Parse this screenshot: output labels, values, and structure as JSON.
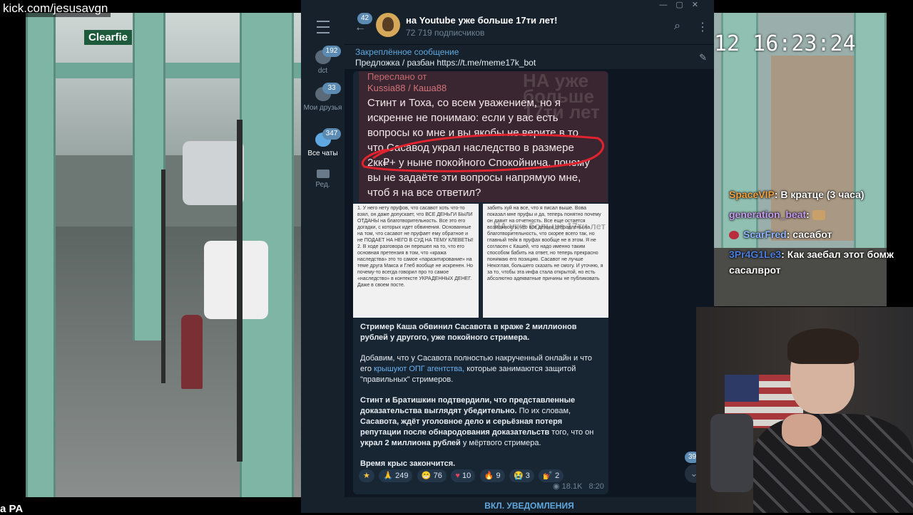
{
  "stream": {
    "kick_url": "kick.com/jesusavgn",
    "bottom_left_label": "a PA",
    "street_sign": "Clearfie",
    "clock": "12 16:23:24"
  },
  "telegram": {
    "rail": [
      {
        "label": "dct",
        "badge": "192"
      },
      {
        "label": "Мои друзья",
        "badge": "33"
      },
      {
        "label": "Все чаты",
        "badge": "347",
        "active": true
      },
      {
        "label": "Ред.",
        "badge": ""
      }
    ],
    "header": {
      "back_badge": "42",
      "channel_title": "на Youtube уже больше 17ти лет!",
      "subscribers": "72 719 подписчиков"
    },
    "pinned": {
      "title": "Закреплённое сообщение",
      "text": "Предложка / разбан https://t.me/meme17k_bot"
    },
    "forwarded": {
      "from_label": "Переслано от",
      "from_user": "Kussia88 / Каша88",
      "text": "Стинт и Тоха, со всем уважением, но я искренне не понимаю: если у вас есть вопросы ко мне и вы якобы не верите в то что Сасавод украл наследство в размере 2кк₽+ у ныне покойного Спокойнича, почему вы не задаёте эти вопросы напрямую мне, чтоб я на все ответил?",
      "watermark": "НА уже больше 17ти лет"
    },
    "screenshots": {
      "left_text": "1. У него нету пруфов, что сасавот хоть что-то взял, он даже допускает, что ВСЕ ДЕНЬГИ БЫЛИ ОТДАНЫ на благотворительность. Все это его догадки, с которых идет обвинения. Основанные на том, что сасавот не пруфает ему обратное и не ПОДАЕТ НА НЕГО В СУД НА ТЕМУ КЛЕВЕТЫ! 2. В ходе разговора он перешел на то, что его основная претензия в том, что «кража наследства» это то самое «паразитирование» на теме друга Макса и Глеб вообще не искренен. Но почему-то всегда говорил про то самое «наследство» в контексте УКРАДЕННЫХ ДЕНЕГ. Даже в своем посте.",
      "right_text": "забить хуй на все, что я писал выше. Вова показал мне пруфы и да, теперь понятно почему он давит на отчетность. Все еще остается возможность, что все деньги отправлены на благотворительность, что скорее всего так, но главный тейк в пруфах вообще не в этом. Я не согласен с Кашей, что надо именно таким способом бабить на ответ, но теперь прекрасно понимаю его позицию. Сасавот не лучше Некоглая, большего сказать не смогу. И уточню, я за то, чтобы эта инфа стала открытой, но есть абсолютно адекватные причины не публиковать",
      "watermark": "НА уже больше 17ти лет"
    },
    "post": {
      "p1": "Стример Каша обвинил Сасавота в краже 2 миллионов рублей у другого, уже покойного стримера.",
      "p2_a": "Добавим, что у Сасавота полностью накрученный онлайн и что его ",
      "p2_link": "крышуют ОПГ агентства,",
      "p2_b": " которые занимаются защитой \"правильных\" стримеров.",
      "p3_a": "Стинт и Братишкин подтвердили, что представленные доказательства выглядят убедительно.",
      "p3_b": " По их словам, ",
      "p3_c": "Сасавота, ждёт уголовное дело и серьёзная потеря репутации после обнародования доказательств",
      "p3_d": " того, что он ",
      "p3_e": "украл 2 миллиона рублей",
      "p3_f": " у мёртвого стримера.",
      "p4": "Время крыс закончится."
    },
    "reactions": [
      {
        "emoji": "★",
        "count": "",
        "color": "#f5c542"
      },
      {
        "emoji": "🙏",
        "count": "249",
        "color": "#e9b44c"
      },
      {
        "emoji": "😁",
        "count": "76",
        "color": "#f2c94c"
      },
      {
        "emoji": "♥",
        "count": "10",
        "color": "#e0435a"
      },
      {
        "emoji": "🔥",
        "count": "9",
        "color": "#f08a24"
      },
      {
        "emoji": "😭",
        "count": "3",
        "color": "#6ab3f3"
      },
      {
        "emoji": "💅",
        "count": "2",
        "color": "#d46ab0"
      }
    ],
    "views": "18.1K",
    "time": "8:20",
    "scroll_badge": "39",
    "notify_label": "ВКЛ. УВЕДОМЛЕНИЯ"
  },
  "chat": [
    {
      "name": "SpaceVIP",
      "name_color": "#f0a040",
      "message": ": В кратце (3 часа)"
    },
    {
      "name": "generation_beat",
      "name_color": "#c79cf0",
      "message": ":"
    },
    {
      "name": "ScarFred",
      "name_color": "#8fb5ff",
      "message": ": сасабот"
    },
    {
      "name": "3Pr4G1Le3",
      "name_color": "#4a7de0",
      "message": ": Как заебал этот бомж сасалврот"
    }
  ]
}
